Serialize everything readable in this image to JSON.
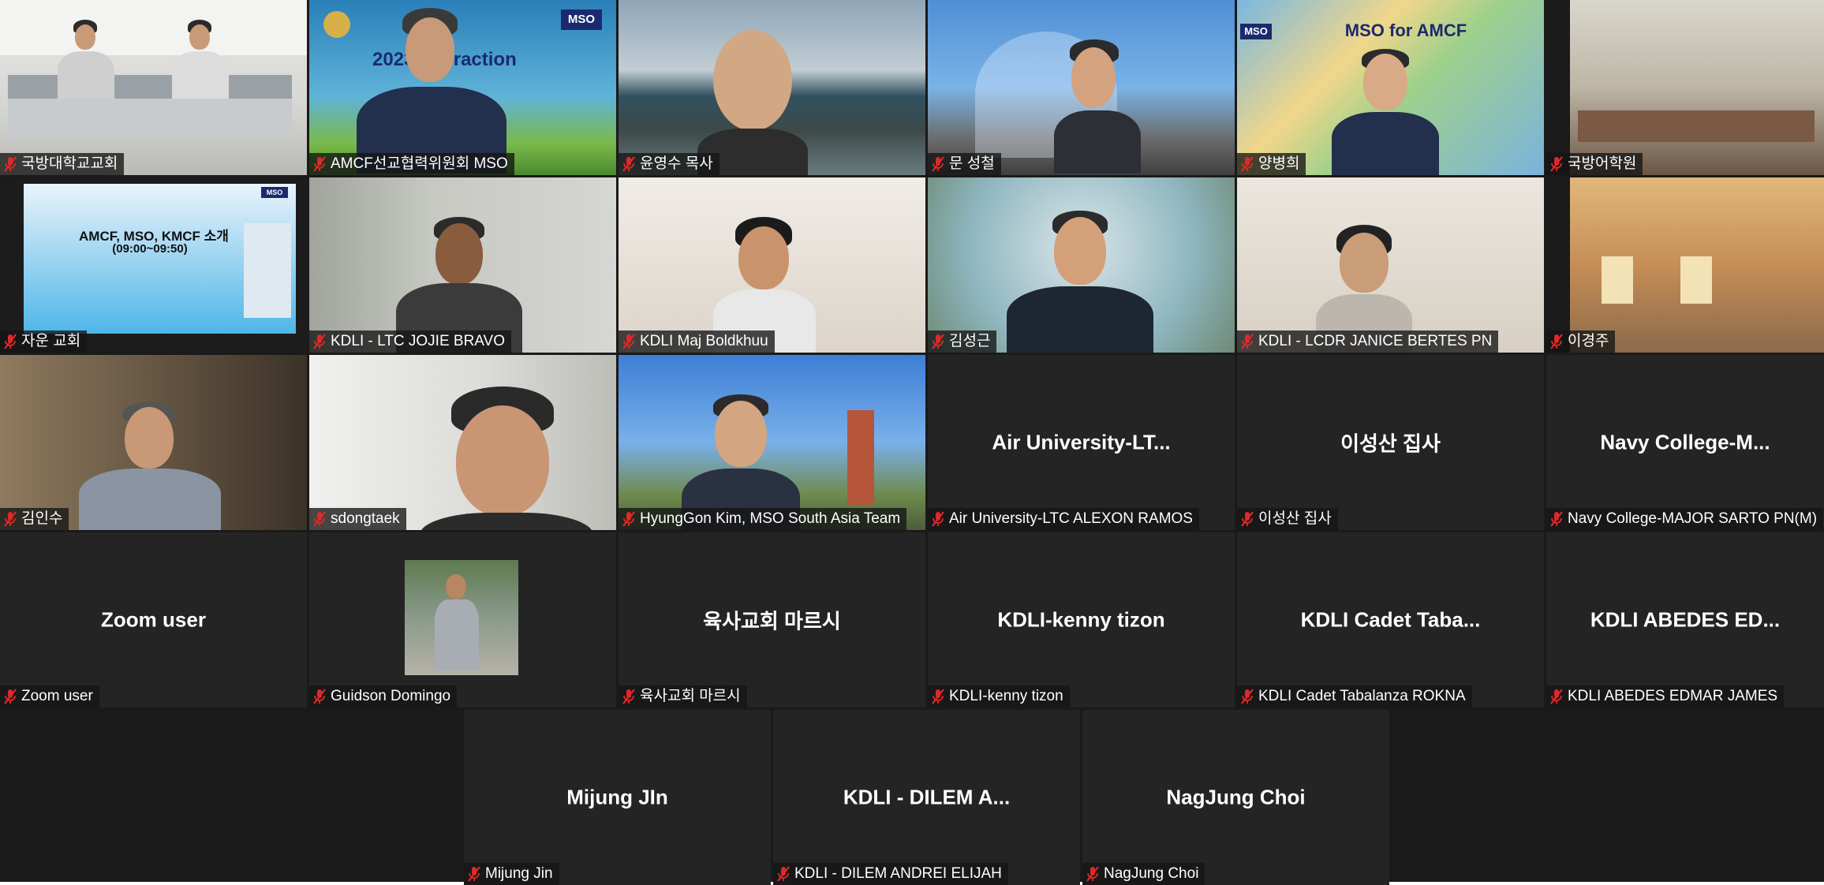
{
  "tiles": [
    {
      "name": "국방대학교교회"
    },
    {
      "name": "AMCF선교협력위원회 MSO",
      "slide_title": "2023 Interaction",
      "logo_text": "MSO"
    },
    {
      "name": "윤영수 목사"
    },
    {
      "name": "문 성철"
    },
    {
      "name": "양병희",
      "slide_title": "MSO for AMCF",
      "logo_text": "MSO"
    },
    {
      "name": "국방어학원"
    },
    {
      "name": "자운 교회",
      "slide_title": "AMCF, MSO, KMCF 소개",
      "slide_time": "(09:00~09:50)",
      "logo_text": "MSO"
    },
    {
      "name": "KDLI - LTC JOJIE BRAVO"
    },
    {
      "name": "KDLI Maj Boldkhuu"
    },
    {
      "name": "김성근"
    },
    {
      "name": "KDLI - LCDR JANICE BERTES PN"
    },
    {
      "name": "이경주"
    },
    {
      "name": "김인수"
    },
    {
      "name": "sdongtaek"
    },
    {
      "name": "HyungGon Kim, MSO South Asia Team"
    },
    {
      "name": "Air University-LTC ALEXON RAMOS",
      "display": "Air University-LT..."
    },
    {
      "name": "이성산 집사",
      "display": "이성산 집사"
    },
    {
      "name": "Navy College-MAJOR SARTO  PN(M)",
      "display": "Navy College-M..."
    },
    {
      "name": "Zoom user",
      "display": "Zoom user"
    },
    {
      "name": "Guidson Domingo"
    },
    {
      "name": "육사교회 마르시",
      "display": "육사교회 마르시"
    },
    {
      "name": "KDLI-kenny tizon",
      "display": "KDLI-kenny tizon"
    },
    {
      "name": "KDLI Cadet Tabalanza ROKNA",
      "display": "KDLI Cadet Taba..."
    },
    {
      "name": "KDLI ABEDES EDMAR JAMES",
      "display": "KDLI ABEDES ED..."
    },
    {
      "name": "Mijung Jin",
      "display": "Mijung JIn"
    },
    {
      "name": "KDLI - DILEM ANDREI ELIJAH",
      "display": "KDLI - DILEM A..."
    },
    {
      "name": "NagJung Choi",
      "display": "NagJung Choi"
    }
  ],
  "icons": {
    "muted": "mic-muted-icon"
  },
  "colors": {
    "muted_red": "#e02828",
    "active_speaker": "#d8d55a",
    "tile_bg": "#242424"
  }
}
